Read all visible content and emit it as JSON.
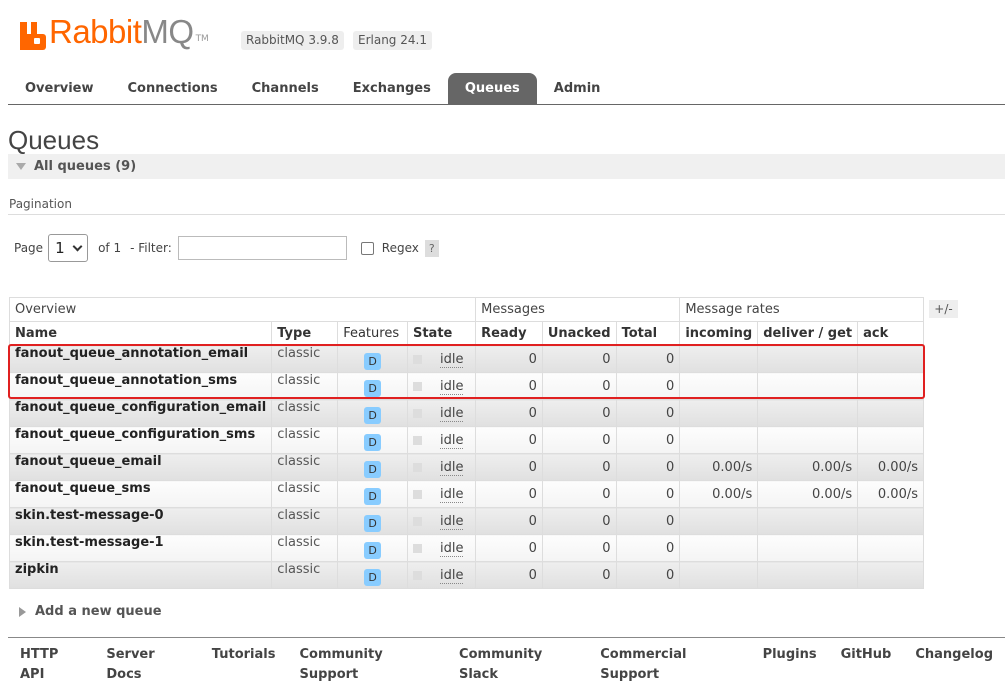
{
  "brand": {
    "name_part1": "Rabbit",
    "name_part2": "MQ",
    "tm": "TM",
    "version": "RabbitMQ 3.9.8",
    "erlang": "Erlang 24.1"
  },
  "nav": {
    "tabs": [
      "Overview",
      "Connections",
      "Channels",
      "Exchanges",
      "Queues",
      "Admin"
    ],
    "selected": "Queues"
  },
  "page": {
    "title": "Queues",
    "section": "All queues (9)"
  },
  "pagination": {
    "label": "Pagination",
    "page_label": "Page",
    "page_value": "1",
    "of_label": "of 1",
    "filter_label": "- Filter:",
    "filter_value": "",
    "regex_label": "Regex",
    "help": "?"
  },
  "table": {
    "groups": [
      "Overview",
      "Messages",
      "Message rates"
    ],
    "toggle": "+/-",
    "columns": [
      "Name",
      "Type",
      "Features",
      "State",
      "Ready",
      "Unacked",
      "Total",
      "incoming",
      "deliver / get",
      "ack"
    ],
    "rows": [
      {
        "name": "fanout_queue_annotation_email",
        "type": "classic",
        "feature": "D",
        "state": "idle",
        "ready": "0",
        "unacked": "0",
        "total": "0",
        "incoming": "",
        "deliver": "",
        "ack": ""
      },
      {
        "name": "fanout_queue_annotation_sms",
        "type": "classic",
        "feature": "D",
        "state": "idle",
        "ready": "0",
        "unacked": "0",
        "total": "0",
        "incoming": "",
        "deliver": "",
        "ack": ""
      },
      {
        "name": "fanout_queue_configuration_email",
        "type": "classic",
        "feature": "D",
        "state": "idle",
        "ready": "0",
        "unacked": "0",
        "total": "0",
        "incoming": "",
        "deliver": "",
        "ack": ""
      },
      {
        "name": "fanout_queue_configuration_sms",
        "type": "classic",
        "feature": "D",
        "state": "idle",
        "ready": "0",
        "unacked": "0",
        "total": "0",
        "incoming": "",
        "deliver": "",
        "ack": ""
      },
      {
        "name": "fanout_queue_email",
        "type": "classic",
        "feature": "D",
        "state": "idle",
        "ready": "0",
        "unacked": "0",
        "total": "0",
        "incoming": "0.00/s",
        "deliver": "0.00/s",
        "ack": "0.00/s"
      },
      {
        "name": "fanout_queue_sms",
        "type": "classic",
        "feature": "D",
        "state": "idle",
        "ready": "0",
        "unacked": "0",
        "total": "0",
        "incoming": "0.00/s",
        "deliver": "0.00/s",
        "ack": "0.00/s"
      },
      {
        "name": "skin.test-message-0",
        "type": "classic",
        "feature": "D",
        "state": "idle",
        "ready": "0",
        "unacked": "0",
        "total": "0",
        "incoming": "",
        "deliver": "",
        "ack": ""
      },
      {
        "name": "skin.test-message-1",
        "type": "classic",
        "feature": "D",
        "state": "idle",
        "ready": "0",
        "unacked": "0",
        "total": "0",
        "incoming": "",
        "deliver": "",
        "ack": ""
      },
      {
        "name": "zipkin",
        "type": "classic",
        "feature": "D",
        "state": "idle",
        "ready": "0",
        "unacked": "0",
        "total": "0",
        "incoming": "",
        "deliver": "",
        "ack": ""
      }
    ]
  },
  "add_queue": "Add a new queue",
  "footer": [
    "HTTP API",
    "Server Docs",
    "Tutorials",
    "Community Support",
    "Community Slack",
    "Commercial Support",
    "Plugins",
    "GitHub",
    "Changelog"
  ],
  "colors": {
    "brand": "#ff6600",
    "tab_selected": "#666666",
    "highlight": "#e02020",
    "durable_badge": "#88ccff"
  }
}
